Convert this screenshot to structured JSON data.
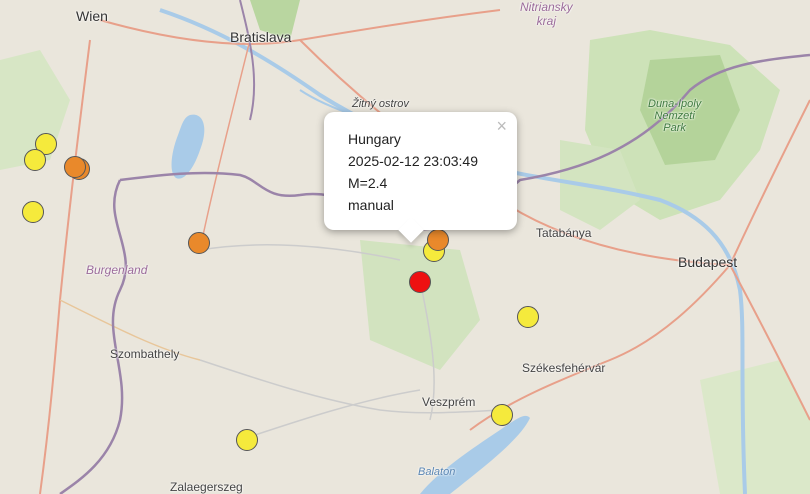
{
  "map": {
    "labels": {
      "wien": "Wien",
      "bratislava": "Bratislava",
      "nitriansky": "Nitriansky\nkraj",
      "zitny": "Žitný ostrov",
      "duna_ipoly": "Duna-Ipoly\nNemzeti\nPark",
      "tatabanya": "Tatabánya",
      "budapest": "Budapest",
      "burgenland": "Burgenland",
      "szombathely": "Szombathely",
      "szekesfehervar": "Székesfehérvár",
      "veszprem": "Veszprém",
      "balaton": "Balaton",
      "zalaegerszeg": "Zalaegerszeg"
    },
    "colors": {
      "yellow": "#f5ea3c",
      "orange": "#e9892b",
      "red": "#ee1111",
      "water": "#a9cbe8",
      "forest": "#c9dfb3",
      "border": "#9b84a9"
    }
  },
  "popup": {
    "country": "Hungary",
    "datetime": "2025-02-12 23:03:49",
    "magnitude": "M=2.4",
    "mode": "manual",
    "close_icon": "×"
  }
}
